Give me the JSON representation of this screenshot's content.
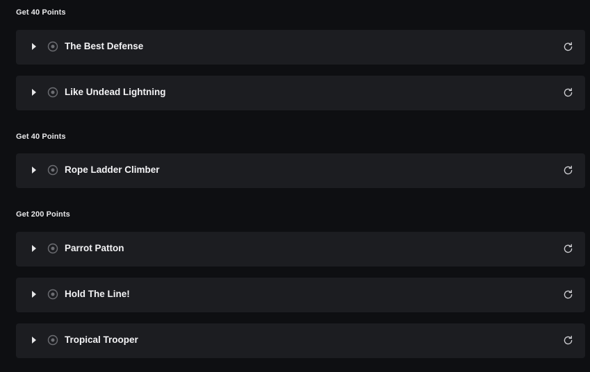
{
  "groups": [
    {
      "title": "Get 40 Points",
      "items": [
        {
          "label": "The Best Defense"
        },
        {
          "label": "Like Undead Lightning"
        }
      ]
    },
    {
      "title": "Get 40 Points",
      "items": [
        {
          "label": "Rope Ladder Climber"
        }
      ]
    },
    {
      "title": "Get 200 Points",
      "items": [
        {
          "label": "Parrot Patton"
        },
        {
          "label": "Hold The Line!"
        },
        {
          "label": "Tropical Trooper"
        }
      ]
    }
  ],
  "icons": {
    "expand": "chevron-right-icon",
    "status": "radio-unchecked-icon",
    "reset": "refresh-icon"
  },
  "colors": {
    "background": "#0e0f12",
    "row": "#1c1d21",
    "text": "#f3f3f5"
  }
}
